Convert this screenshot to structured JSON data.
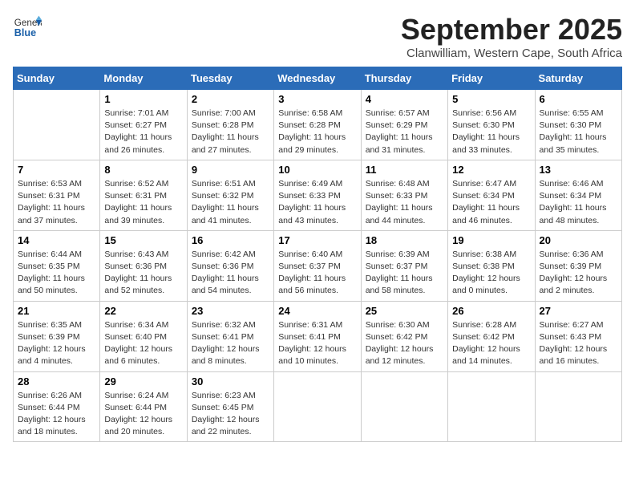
{
  "header": {
    "logo_general": "General",
    "logo_blue": "Blue",
    "month": "September 2025",
    "location": "Clanwilliam, Western Cape, South Africa"
  },
  "days_of_week": [
    "Sunday",
    "Monday",
    "Tuesday",
    "Wednesday",
    "Thursday",
    "Friday",
    "Saturday"
  ],
  "weeks": [
    [
      {
        "day": "",
        "sunrise": "",
        "sunset": "",
        "daylight": ""
      },
      {
        "day": "1",
        "sunrise": "Sunrise: 7:01 AM",
        "sunset": "Sunset: 6:27 PM",
        "daylight": "Daylight: 11 hours and 26 minutes."
      },
      {
        "day": "2",
        "sunrise": "Sunrise: 7:00 AM",
        "sunset": "Sunset: 6:28 PM",
        "daylight": "Daylight: 11 hours and 27 minutes."
      },
      {
        "day": "3",
        "sunrise": "Sunrise: 6:58 AM",
        "sunset": "Sunset: 6:28 PM",
        "daylight": "Daylight: 11 hours and 29 minutes."
      },
      {
        "day": "4",
        "sunrise": "Sunrise: 6:57 AM",
        "sunset": "Sunset: 6:29 PM",
        "daylight": "Daylight: 11 hours and 31 minutes."
      },
      {
        "day": "5",
        "sunrise": "Sunrise: 6:56 AM",
        "sunset": "Sunset: 6:30 PM",
        "daylight": "Daylight: 11 hours and 33 minutes."
      },
      {
        "day": "6",
        "sunrise": "Sunrise: 6:55 AM",
        "sunset": "Sunset: 6:30 PM",
        "daylight": "Daylight: 11 hours and 35 minutes."
      }
    ],
    [
      {
        "day": "7",
        "sunrise": "Sunrise: 6:53 AM",
        "sunset": "Sunset: 6:31 PM",
        "daylight": "Daylight: 11 hours and 37 minutes."
      },
      {
        "day": "8",
        "sunrise": "Sunrise: 6:52 AM",
        "sunset": "Sunset: 6:31 PM",
        "daylight": "Daylight: 11 hours and 39 minutes."
      },
      {
        "day": "9",
        "sunrise": "Sunrise: 6:51 AM",
        "sunset": "Sunset: 6:32 PM",
        "daylight": "Daylight: 11 hours and 41 minutes."
      },
      {
        "day": "10",
        "sunrise": "Sunrise: 6:49 AM",
        "sunset": "Sunset: 6:33 PM",
        "daylight": "Daylight: 11 hours and 43 minutes."
      },
      {
        "day": "11",
        "sunrise": "Sunrise: 6:48 AM",
        "sunset": "Sunset: 6:33 PM",
        "daylight": "Daylight: 11 hours and 44 minutes."
      },
      {
        "day": "12",
        "sunrise": "Sunrise: 6:47 AM",
        "sunset": "Sunset: 6:34 PM",
        "daylight": "Daylight: 11 hours and 46 minutes."
      },
      {
        "day": "13",
        "sunrise": "Sunrise: 6:46 AM",
        "sunset": "Sunset: 6:34 PM",
        "daylight": "Daylight: 11 hours and 48 minutes."
      }
    ],
    [
      {
        "day": "14",
        "sunrise": "Sunrise: 6:44 AM",
        "sunset": "Sunset: 6:35 PM",
        "daylight": "Daylight: 11 hours and 50 minutes."
      },
      {
        "day": "15",
        "sunrise": "Sunrise: 6:43 AM",
        "sunset": "Sunset: 6:36 PM",
        "daylight": "Daylight: 11 hours and 52 minutes."
      },
      {
        "day": "16",
        "sunrise": "Sunrise: 6:42 AM",
        "sunset": "Sunset: 6:36 PM",
        "daylight": "Daylight: 11 hours and 54 minutes."
      },
      {
        "day": "17",
        "sunrise": "Sunrise: 6:40 AM",
        "sunset": "Sunset: 6:37 PM",
        "daylight": "Daylight: 11 hours and 56 minutes."
      },
      {
        "day": "18",
        "sunrise": "Sunrise: 6:39 AM",
        "sunset": "Sunset: 6:37 PM",
        "daylight": "Daylight: 11 hours and 58 minutes."
      },
      {
        "day": "19",
        "sunrise": "Sunrise: 6:38 AM",
        "sunset": "Sunset: 6:38 PM",
        "daylight": "Daylight: 12 hours and 0 minutes."
      },
      {
        "day": "20",
        "sunrise": "Sunrise: 6:36 AM",
        "sunset": "Sunset: 6:39 PM",
        "daylight": "Daylight: 12 hours and 2 minutes."
      }
    ],
    [
      {
        "day": "21",
        "sunrise": "Sunrise: 6:35 AM",
        "sunset": "Sunset: 6:39 PM",
        "daylight": "Daylight: 12 hours and 4 minutes."
      },
      {
        "day": "22",
        "sunrise": "Sunrise: 6:34 AM",
        "sunset": "Sunset: 6:40 PM",
        "daylight": "Daylight: 12 hours and 6 minutes."
      },
      {
        "day": "23",
        "sunrise": "Sunrise: 6:32 AM",
        "sunset": "Sunset: 6:41 PM",
        "daylight": "Daylight: 12 hours and 8 minutes."
      },
      {
        "day": "24",
        "sunrise": "Sunrise: 6:31 AM",
        "sunset": "Sunset: 6:41 PM",
        "daylight": "Daylight: 12 hours and 10 minutes."
      },
      {
        "day": "25",
        "sunrise": "Sunrise: 6:30 AM",
        "sunset": "Sunset: 6:42 PM",
        "daylight": "Daylight: 12 hours and 12 minutes."
      },
      {
        "day": "26",
        "sunrise": "Sunrise: 6:28 AM",
        "sunset": "Sunset: 6:42 PM",
        "daylight": "Daylight: 12 hours and 14 minutes."
      },
      {
        "day": "27",
        "sunrise": "Sunrise: 6:27 AM",
        "sunset": "Sunset: 6:43 PM",
        "daylight": "Daylight: 12 hours and 16 minutes."
      }
    ],
    [
      {
        "day": "28",
        "sunrise": "Sunrise: 6:26 AM",
        "sunset": "Sunset: 6:44 PM",
        "daylight": "Daylight: 12 hours and 18 minutes."
      },
      {
        "day": "29",
        "sunrise": "Sunrise: 6:24 AM",
        "sunset": "Sunset: 6:44 PM",
        "daylight": "Daylight: 12 hours and 20 minutes."
      },
      {
        "day": "30",
        "sunrise": "Sunrise: 6:23 AM",
        "sunset": "Sunset: 6:45 PM",
        "daylight": "Daylight: 12 hours and 22 minutes."
      },
      {
        "day": "",
        "sunrise": "",
        "sunset": "",
        "daylight": ""
      },
      {
        "day": "",
        "sunrise": "",
        "sunset": "",
        "daylight": ""
      },
      {
        "day": "",
        "sunrise": "",
        "sunset": "",
        "daylight": ""
      },
      {
        "day": "",
        "sunrise": "",
        "sunset": "",
        "daylight": ""
      }
    ]
  ]
}
